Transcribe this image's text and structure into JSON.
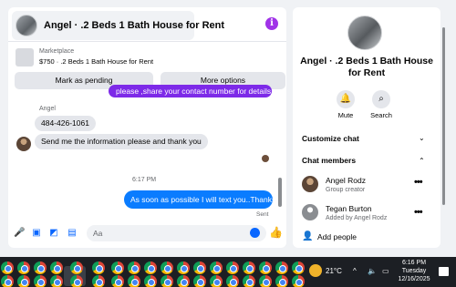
{
  "header": {
    "title": "Angel · .2 Beds 1 Bath House for Rent",
    "info_icon": "i"
  },
  "marketplace": {
    "label": "Marketplace",
    "listing": "$750 · .2 Beds 1 Bath House for Rent",
    "btn_pending": "Mark as pending",
    "btn_options": "More options"
  },
  "messages": {
    "out_partial": "please ,share your contact  number for details.",
    "sender": "Angel",
    "phone": "484-426-1061",
    "request": "Send me the information please and thank you",
    "time": "6:17 PM",
    "reply": "As soon as possible I will text you..Thanks",
    "status": "Sent"
  },
  "composer": {
    "placeholder": "Aa"
  },
  "details": {
    "name": "Angel · .2 Beds 1 Bath House for Rent",
    "mute": "Mute",
    "search": "Search",
    "customize": "Customize chat",
    "members_title": "Chat members",
    "members": [
      {
        "name": "Angel Rodz",
        "sub": "Group creator"
      },
      {
        "name": "Tegan Burton",
        "sub": "Added by Angel Rodz"
      }
    ],
    "add_people": "Add people"
  },
  "taskbar": {
    "temp": "21°C",
    "time": "6:16 PM",
    "day": "Tuesday",
    "date": "12/16/2025"
  },
  "colors": {
    "accent_purple": "#7d2ae8",
    "accent_blue": "#0a7cff",
    "link_blue": "#0866ff"
  }
}
